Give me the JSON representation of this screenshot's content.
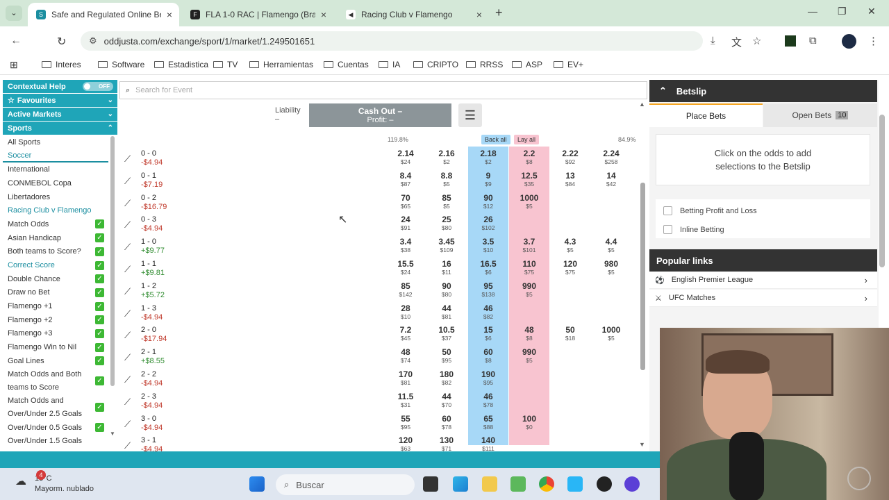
{
  "browser": {
    "tabs": [
      {
        "title": "Safe and Regulated Online Betting",
        "favicon_color": "#1b8ea0",
        "favicon_char": "S"
      },
      {
        "title": "FLA 1-0 RAC | Flamengo (Bra) v",
        "favicon_color": "#222222",
        "favicon_char": "F"
      },
      {
        "title": "Racing Club v Flamengo",
        "favicon_color": "#444444",
        "favicon_char": "◀"
      }
    ],
    "url": "oddjusta.com/exchange/sport/1/market/1.249501651",
    "bookmarks": [
      "Interes",
      "Software",
      "Estadistica",
      "TV",
      "Herramientas",
      "Cuentas",
      "IA",
      "CRIPTO",
      "RRSS",
      "ASP",
      "EV+"
    ]
  },
  "sidebar": {
    "contextual_help": "Contextual Help",
    "toggle": "OFF",
    "favourites": "Favourites",
    "active_markets": "Active Markets",
    "sports": "Sports",
    "items": [
      {
        "label": "All Sports",
        "check": false
      },
      {
        "label": "Soccer",
        "check": false
      },
      {
        "label": "International",
        "check": false
      },
      {
        "label": "CONMEBOL Copa",
        "check": false
      },
      {
        "label": "Libertadores",
        "check": false
      },
      {
        "label": "Racing Club v Flamengo",
        "check": false
      },
      {
        "label": "Match Odds",
        "check": true
      },
      {
        "label": "Asian Handicap",
        "check": true
      },
      {
        "label": "Both teams to Score?",
        "check": true
      },
      {
        "label": "Correct Score",
        "check": true
      },
      {
        "label": "Double Chance",
        "check": true
      },
      {
        "label": "Draw no Bet",
        "check": true
      },
      {
        "label": "Flamengo +1",
        "check": true
      },
      {
        "label": "Flamengo +2",
        "check": true
      },
      {
        "label": "Flamengo +3",
        "check": true
      },
      {
        "label": "Flamengo Win to Nil",
        "check": true
      },
      {
        "label": "Goal Lines",
        "check": true
      },
      {
        "label": "Match Odds and Both teams to Score",
        "check": true
      },
      {
        "label": "Match Odds and Over/Under 2.5 Goals",
        "check": true
      },
      {
        "label": "Over/Under 0.5 Goals",
        "check": true
      },
      {
        "label": "Over/Under 1.5 Goals",
        "check": false
      }
    ]
  },
  "market": {
    "search_placeholder": "Search for Event",
    "liability_label": "Liability",
    "liability_value": "–",
    "cashout_title": "Cash Out –",
    "cashout_profit": "Profit: –",
    "back_pct": "119.8%",
    "lay_pct": "84.9%",
    "back_all": "Back all",
    "lay_all": "Lay all",
    "rows": [
      {
        "name": "0 - 0",
        "pl": "-$4.94",
        "neg": true,
        "odds": [
          [
            "2.14",
            "$24"
          ],
          [
            "2.16",
            "$2"
          ],
          [
            "2.18",
            "$2"
          ],
          [
            "2.2",
            "$8"
          ],
          [
            "2.22",
            "$92"
          ],
          [
            "2.24",
            "$258"
          ]
        ]
      },
      {
        "name": "0 - 1",
        "pl": "-$7.19",
        "neg": true,
        "odds": [
          [
            "8.4",
            "$87"
          ],
          [
            "8.8",
            "$5"
          ],
          [
            "9",
            "$9"
          ],
          [
            "12.5",
            "$35"
          ],
          [
            "13",
            "$84"
          ],
          [
            "14",
            "$42"
          ]
        ]
      },
      {
        "name": "0 - 2",
        "pl": "-$16.79",
        "neg": true,
        "odds": [
          [
            "70",
            "$65"
          ],
          [
            "85",
            "$5"
          ],
          [
            "90",
            "$12"
          ],
          [
            "1000",
            "$5"
          ],
          [
            "",
            ""
          ],
          [
            "",
            ""
          ]
        ]
      },
      {
        "name": "0 - 3",
        "pl": "-$4.94",
        "neg": true,
        "odds": [
          [
            "24",
            "$91"
          ],
          [
            "25",
            "$80"
          ],
          [
            "26",
            "$102"
          ],
          [
            "",
            ""
          ],
          [
            "",
            ""
          ],
          [
            "",
            ""
          ]
        ]
      },
      {
        "name": "1 - 0",
        "pl": "+$9.77",
        "neg": false,
        "odds": [
          [
            "3.4",
            "$38"
          ],
          [
            "3.45",
            "$109"
          ],
          [
            "3.5",
            "$10"
          ],
          [
            "3.7",
            "$101"
          ],
          [
            "4.3",
            "$5"
          ],
          [
            "4.4",
            "$5"
          ]
        ]
      },
      {
        "name": "1 - 1",
        "pl": "+$9.81",
        "neg": false,
        "odds": [
          [
            "15.5",
            "$24"
          ],
          [
            "16",
            "$11"
          ],
          [
            "16.5",
            "$6"
          ],
          [
            "110",
            "$75"
          ],
          [
            "120",
            "$75"
          ],
          [
            "980",
            "$5"
          ]
        ]
      },
      {
        "name": "1 - 2",
        "pl": "+$5.72",
        "neg": false,
        "odds": [
          [
            "85",
            "$142"
          ],
          [
            "90",
            "$80"
          ],
          [
            "95",
            "$138"
          ],
          [
            "990",
            "$5"
          ],
          [
            "",
            ""
          ],
          [
            "",
            ""
          ]
        ]
      },
      {
        "name": "1 - 3",
        "pl": "-$4.94",
        "neg": true,
        "odds": [
          [
            "28",
            "$10"
          ],
          [
            "44",
            "$81"
          ],
          [
            "46",
            "$82"
          ],
          [
            "",
            ""
          ],
          [
            "",
            ""
          ],
          [
            "",
            ""
          ]
        ]
      },
      {
        "name": "2 - 0",
        "pl": "-$17.94",
        "neg": true,
        "odds": [
          [
            "7.2",
            "$45"
          ],
          [
            "10.5",
            "$37"
          ],
          [
            "15",
            "$6"
          ],
          [
            "48",
            "$8"
          ],
          [
            "50",
            "$18"
          ],
          [
            "1000",
            "$5"
          ]
        ]
      },
      {
        "name": "2 - 1",
        "pl": "+$8.55",
        "neg": false,
        "odds": [
          [
            "48",
            "$74"
          ],
          [
            "50",
            "$95"
          ],
          [
            "60",
            "$8"
          ],
          [
            "990",
            "$5"
          ],
          [
            "",
            ""
          ],
          [
            "",
            ""
          ]
        ]
      },
      {
        "name": "2 - 2",
        "pl": "-$4.94",
        "neg": true,
        "odds": [
          [
            "170",
            "$81"
          ],
          [
            "180",
            "$82"
          ],
          [
            "190",
            "$95"
          ],
          [
            "",
            ""
          ],
          [
            "",
            ""
          ],
          [
            "",
            ""
          ]
        ]
      },
      {
        "name": "2 - 3",
        "pl": "-$4.94",
        "neg": true,
        "odds": [
          [
            "11.5",
            "$31"
          ],
          [
            "44",
            "$70"
          ],
          [
            "46",
            "$78"
          ],
          [
            "",
            ""
          ],
          [
            "",
            ""
          ],
          [
            "",
            ""
          ]
        ]
      },
      {
        "name": "3 - 0",
        "pl": "-$4.94",
        "neg": true,
        "odds": [
          [
            "55",
            "$95"
          ],
          [
            "60",
            "$78"
          ],
          [
            "65",
            "$88"
          ],
          [
            "100",
            "$0"
          ],
          [
            "",
            ""
          ],
          [
            "",
            ""
          ]
        ]
      },
      {
        "name": "3 - 1",
        "pl": "-$4.94",
        "neg": true,
        "odds": [
          [
            "120",
            "$63"
          ],
          [
            "130",
            "$71"
          ],
          [
            "140",
            "$111"
          ],
          [
            "",
            ""
          ],
          [
            "",
            ""
          ],
          [
            "",
            ""
          ]
        ]
      }
    ]
  },
  "betslip": {
    "title": "Betslip",
    "tab_place": "Place Bets",
    "tab_open": "Open Bets",
    "open_count": "10",
    "empty_msg_1": "Click on the odds to add",
    "empty_msg_2": "selections to the Betslip",
    "opt_pl": "Betting Profit and Loss",
    "opt_inline": "Inline Betting",
    "popular_title": "Popular links",
    "links": [
      "English Premier League",
      "UFC Matches"
    ]
  },
  "taskbar": {
    "weather_badge": "4",
    "temp": "13°C",
    "weather_desc": "Mayorm. nublado",
    "search": "Buscar"
  },
  "colors": {
    "accent": "#1fa5b8",
    "back": "#a7d8f7",
    "lay": "#f8c4d0",
    "neg": "#c0392b",
    "pos": "#2e8b2e"
  }
}
